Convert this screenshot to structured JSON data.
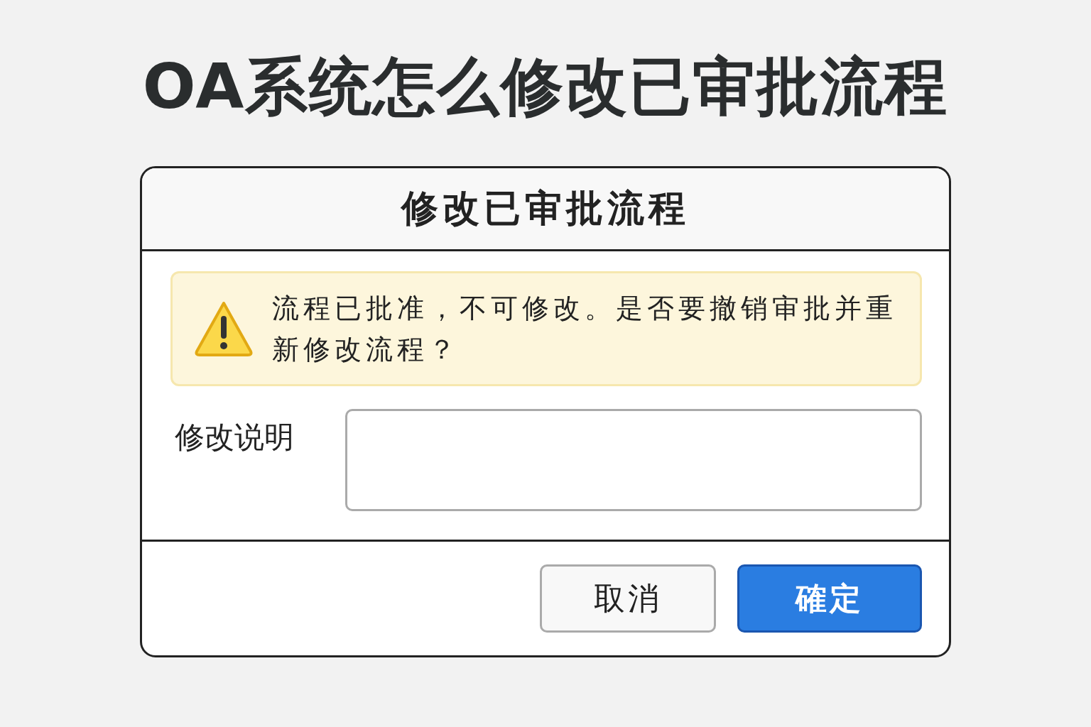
{
  "heading": "OA系统怎么修改已审批流程",
  "dialog": {
    "title": "修改已审批流程",
    "warning": {
      "message": "流程已批准，不可修改。是否要撤销审批并重新修改流程？"
    },
    "field": {
      "label": "修改说明"
    },
    "buttons": [
      {
        "label": "取消",
        "kind": "secondary"
      },
      {
        "label": "確定",
        "kind": "primary"
      }
    ]
  }
}
